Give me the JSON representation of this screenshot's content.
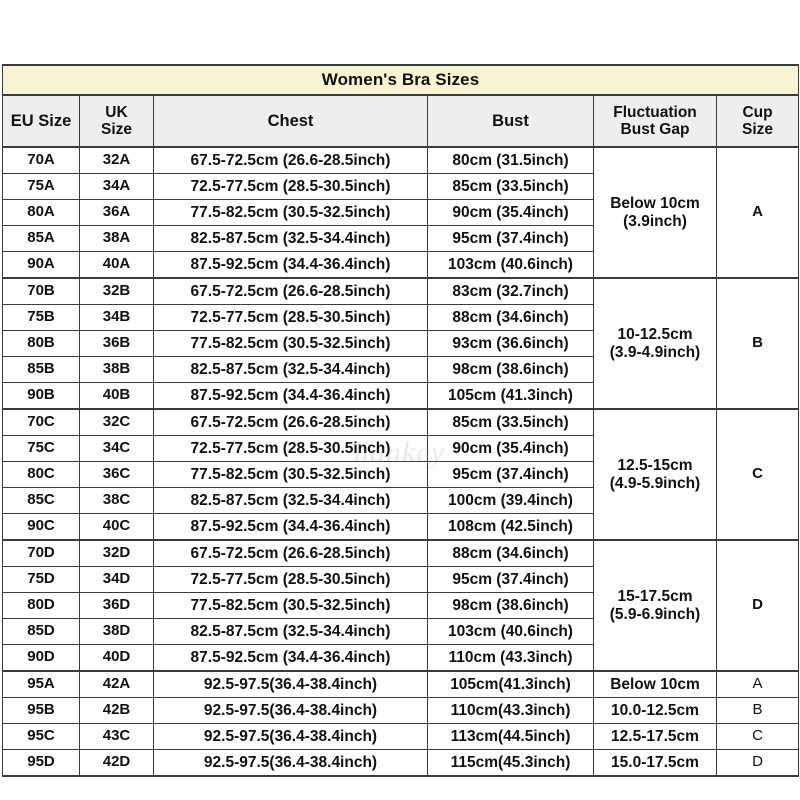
{
  "title": "Women's Bra Sizes",
  "watermark": "hankey",
  "columns": {
    "eu": "EU Size",
    "uk_line1": "UK",
    "uk_line2": "Size",
    "chest": "Chest",
    "bust": "Bust",
    "fluctuation_line1": "Fluctuation",
    "fluctuation_line2": "Bust Gap",
    "cup_line1": "Cup",
    "cup_line2": "Size"
  },
  "groups": [
    {
      "cup": "A",
      "fluctuation_line1": "Below 10cm",
      "fluctuation_line2": "(3.9inch)",
      "rows": [
        {
          "eu": "70A",
          "uk": "32A",
          "chest": "67.5-72.5cm (26.6-28.5inch)",
          "bust": "80cm (31.5inch)"
        },
        {
          "eu": "75A",
          "uk": "34A",
          "chest": "72.5-77.5cm (28.5-30.5inch)",
          "bust": "85cm (33.5inch)"
        },
        {
          "eu": "80A",
          "uk": "36A",
          "chest": "77.5-82.5cm (30.5-32.5inch)",
          "bust": "90cm (35.4inch)"
        },
        {
          "eu": "85A",
          "uk": "38A",
          "chest": "82.5-87.5cm (32.5-34.4inch)",
          "bust": "95cm (37.4inch)"
        },
        {
          "eu": "90A",
          "uk": "40A",
          "chest": "87.5-92.5cm (34.4-36.4inch)",
          "bust": "103cm (40.6inch)"
        }
      ]
    },
    {
      "cup": "B",
      "fluctuation_line1": "10-12.5cm",
      "fluctuation_line2": "(3.9-4.9inch)",
      "rows": [
        {
          "eu": "70B",
          "uk": "32B",
          "chest": "67.5-72.5cm (26.6-28.5inch)",
          "bust": "83cm (32.7inch)"
        },
        {
          "eu": "75B",
          "uk": "34B",
          "chest": "72.5-77.5cm (28.5-30.5inch)",
          "bust": "88cm (34.6inch)"
        },
        {
          "eu": "80B",
          "uk": "36B",
          "chest": "77.5-82.5cm (30.5-32.5inch)",
          "bust": "93cm (36.6inch)"
        },
        {
          "eu": "85B",
          "uk": "38B",
          "chest": "82.5-87.5cm (32.5-34.4inch)",
          "bust": "98cm (38.6inch)"
        },
        {
          "eu": "90B",
          "uk": "40B",
          "chest": "87.5-92.5cm (34.4-36.4inch)",
          "bust": "105cm (41.3inch)"
        }
      ]
    },
    {
      "cup": "C",
      "fluctuation_line1": "12.5-15cm",
      "fluctuation_line2": "(4.9-5.9inch)",
      "rows": [
        {
          "eu": "70C",
          "uk": "32C",
          "chest": "67.5-72.5cm (26.6-28.5inch)",
          "bust": "85cm (33.5inch)"
        },
        {
          "eu": "75C",
          "uk": "34C",
          "chest": "72.5-77.5cm (28.5-30.5inch)",
          "bust": "90cm (35.4inch)"
        },
        {
          "eu": "80C",
          "uk": "36C",
          "chest": "77.5-82.5cm (30.5-32.5inch)",
          "bust": "95cm (37.4inch)"
        },
        {
          "eu": "85C",
          "uk": "38C",
          "chest": "82.5-87.5cm (32.5-34.4inch)",
          "bust": "100cm (39.4inch)"
        },
        {
          "eu": "90C",
          "uk": "40C",
          "chest": "87.5-92.5cm (34.4-36.4inch)",
          "bust": "108cm (42.5inch)"
        }
      ]
    },
    {
      "cup": "D",
      "fluctuation_line1": "15-17.5cm",
      "fluctuation_line2": "(5.9-6.9inch)",
      "rows": [
        {
          "eu": "70D",
          "uk": "32D",
          "chest": "67.5-72.5cm (26.6-28.5inch)",
          "bust": "88cm (34.6inch)"
        },
        {
          "eu": "75D",
          "uk": "34D",
          "chest": "72.5-77.5cm (28.5-30.5inch)",
          "bust": "95cm (37.4inch)"
        },
        {
          "eu": "80D",
          "uk": "36D",
          "chest": "77.5-82.5cm (30.5-32.5inch)",
          "bust": "98cm (38.6inch)"
        },
        {
          "eu": "85D",
          "uk": "38D",
          "chest": "82.5-87.5cm (32.5-34.4inch)",
          "bust": "103cm (40.6inch)"
        },
        {
          "eu": "90D",
          "uk": "40D",
          "chest": "87.5-92.5cm (34.4-36.4inch)",
          "bust": "110cm (43.3inch)"
        }
      ]
    }
  ],
  "tail_rows": [
    {
      "eu": "95A",
      "uk": "42A",
      "chest": "92.5-97.5(36.4-38.4inch)",
      "bust": "105cm(41.3inch)",
      "fluctuation": "Below 10cm",
      "cup": "A"
    },
    {
      "eu": "95B",
      "uk": "42B",
      "chest": "92.5-97.5(36.4-38.4inch)",
      "bust": "110cm(43.3inch)",
      "fluctuation": "10.0-12.5cm",
      "cup": "B"
    },
    {
      "eu": "95C",
      "uk": "43C",
      "chest": "92.5-97.5(36.4-38.4inch)",
      "bust": "113cm(44.5inch)",
      "fluctuation": "12.5-17.5cm",
      "cup": "C"
    },
    {
      "eu": "95D",
      "uk": "42D",
      "chest": "92.5-97.5(36.4-38.4inch)",
      "bust": "115cm(45.3inch)",
      "fluctuation": "15.0-17.5cm",
      "cup": "D"
    }
  ],
  "colors": {
    "title_bg": "#f7f4d4",
    "header_bg": "#eeeeee",
    "border": "#3b3b3b",
    "text": "#111111"
  }
}
